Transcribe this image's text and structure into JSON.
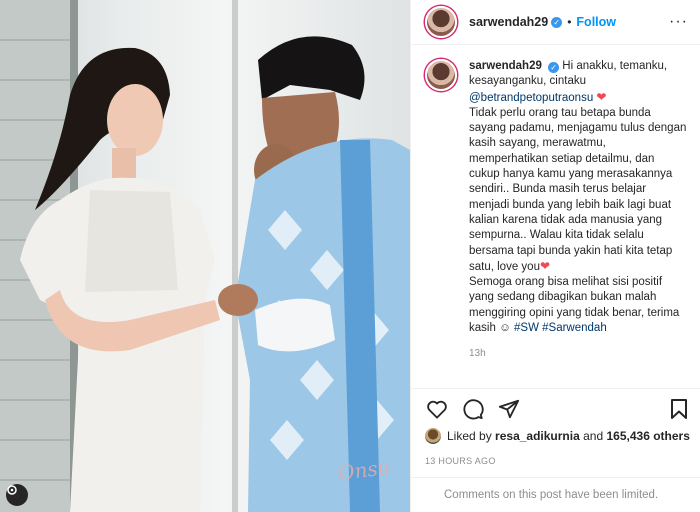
{
  "post": {
    "username": "sarwendah29",
    "follow_label": "Follow",
    "more_label": "···",
    "watermark": "Onsu"
  },
  "caption": {
    "username": "sarwendah29",
    "line1": "Hi anakku, temanku, kesayanganku, cintaku",
    "mention": "@betrandpetoputraonsu",
    "para1": "Tidak perlu orang tau betapa bunda sayang padamu, menjagamu tulus dengan kasih sayang, merawatmu, memperhatikan setiap detailmu, dan cukup hanya kamu yang merasakannya sendiri.. Bunda masih terus belajar menjadi bunda yang lebih baik lagi buat kalian karena tidak ada manusia yang sempurna.. Walau kita tidak selalu bersama tapi bunda yakin hati kita tetap satu, love you",
    "para2": "Semoga orang bisa melihat sisi positif yang sedang dibagikan bukan malah menggiring opini yang tidak benar, terima kasih",
    "hashtag1": "#SW",
    "hashtag2": "#Sarwendah",
    "time": "13h"
  },
  "likes": {
    "liked_by": "Liked by",
    "user": "resa_adikurnia",
    "and": "and",
    "count": "165,436 others"
  },
  "time_ago": "13 HOURS AGO",
  "comments_notice": "Comments on this post have been limited.",
  "icons": [
    "heart-icon",
    "comment-icon",
    "share-icon",
    "bookmark-icon",
    "verified-icon",
    "threads-icon"
  ],
  "colors": {
    "accent": "#0095f6",
    "verified": "#3897f0",
    "link": "#00376b",
    "heart": "#ed4956"
  }
}
